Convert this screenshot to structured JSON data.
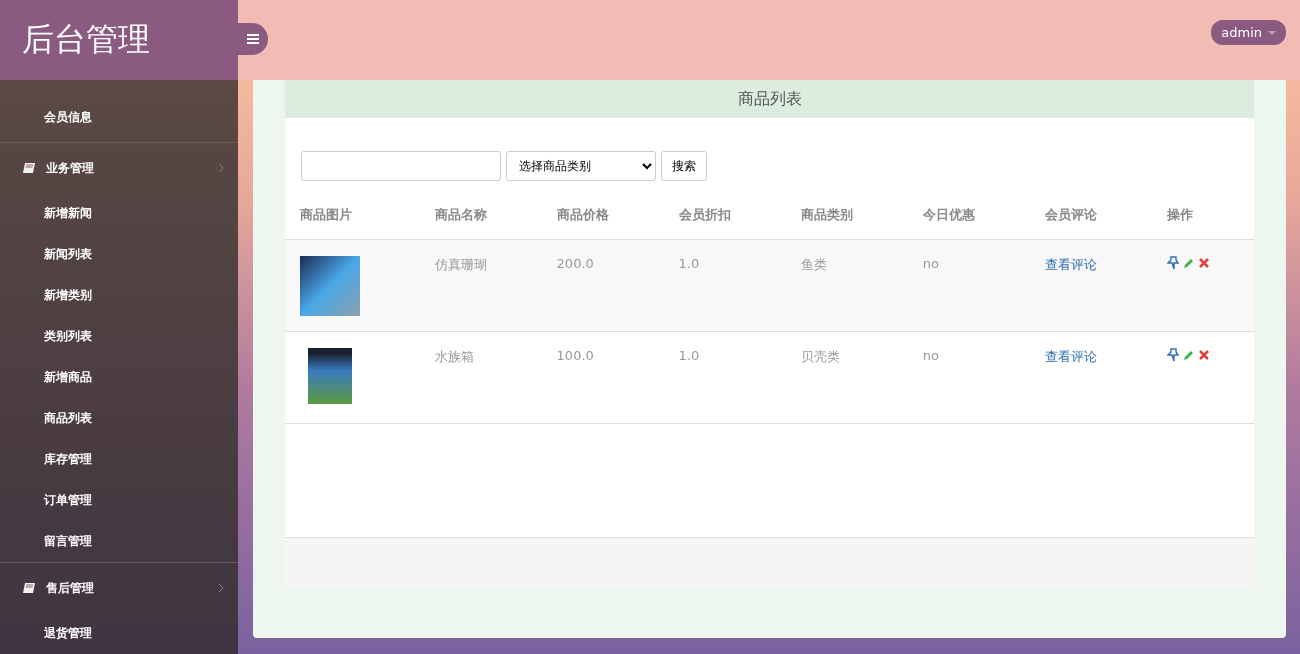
{
  "brand": "后台管理",
  "user_menu": {
    "label": "admin"
  },
  "sidebar": {
    "sections": [
      {
        "items": [
          "会员信息"
        ]
      },
      {
        "title": "业务管理",
        "items": [
          "新增新闻",
          "新闻列表",
          "新增类别",
          "类别列表",
          "新增商品",
          "商品列表",
          "库存管理",
          "订单管理",
          "留言管理"
        ]
      },
      {
        "title": "售后管理",
        "items": [
          "退货管理"
        ]
      }
    ]
  },
  "panel": {
    "title": "商品列表"
  },
  "search": {
    "category_select": "选择商品类别",
    "button": "搜索"
  },
  "table": {
    "columns": [
      "商品图片",
      "商品名称",
      "商品价格",
      "会员折扣",
      "商品类别",
      "今日优惠",
      "会员评论",
      "操作"
    ],
    "rows": [
      {
        "name": "仿真珊瑚",
        "price": "200.0",
        "discount": "1.0",
        "category": "鱼类",
        "special": "no",
        "comments": "查看评论"
      },
      {
        "name": "水族箱",
        "price": "100.0",
        "discount": "1.0",
        "category": "贝壳类",
        "special": "no",
        "comments": "查看评论"
      }
    ]
  }
}
